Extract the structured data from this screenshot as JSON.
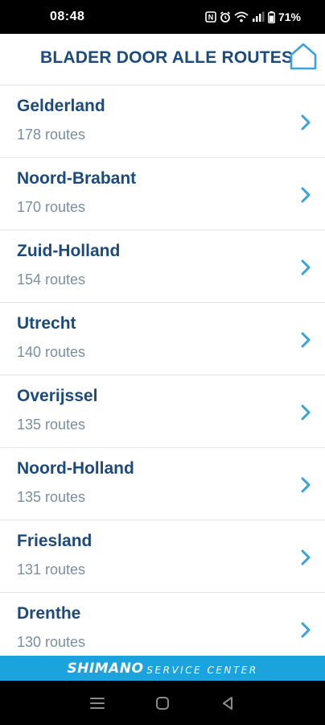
{
  "status_bar": {
    "time": "08:48",
    "battery": "71%",
    "icons": [
      "nfc-icon",
      "alarm-icon",
      "wifi-icon",
      "signal-icon",
      "battery-icon"
    ]
  },
  "header": {
    "title": "BLADER DOOR ALLE ROUTES",
    "home_icon": "home-icon",
    "accent_color": "#1d4a7c"
  },
  "routes": [
    {
      "name": "Gelderland",
      "count": "178 routes"
    },
    {
      "name": "Noord-Brabant",
      "count": "170 routes"
    },
    {
      "name": "Zuid-Holland",
      "count": "154 routes"
    },
    {
      "name": "Utrecht",
      "count": "140 routes"
    },
    {
      "name": "Overijssel",
      "count": "135 routes"
    },
    {
      "name": "Noord-Holland",
      "count": "135 routes"
    },
    {
      "name": "Friesland",
      "count": "131 routes"
    },
    {
      "name": "Drenthe",
      "count": "130 routes"
    }
  ],
  "footer": {
    "brand": "SHIMANO",
    "subtitle": "SERVICE CENTER",
    "color": "#1aa3dc"
  },
  "nav_bar": {
    "buttons": [
      "recent-apps-icon",
      "home-nav-icon",
      "back-icon"
    ]
  }
}
